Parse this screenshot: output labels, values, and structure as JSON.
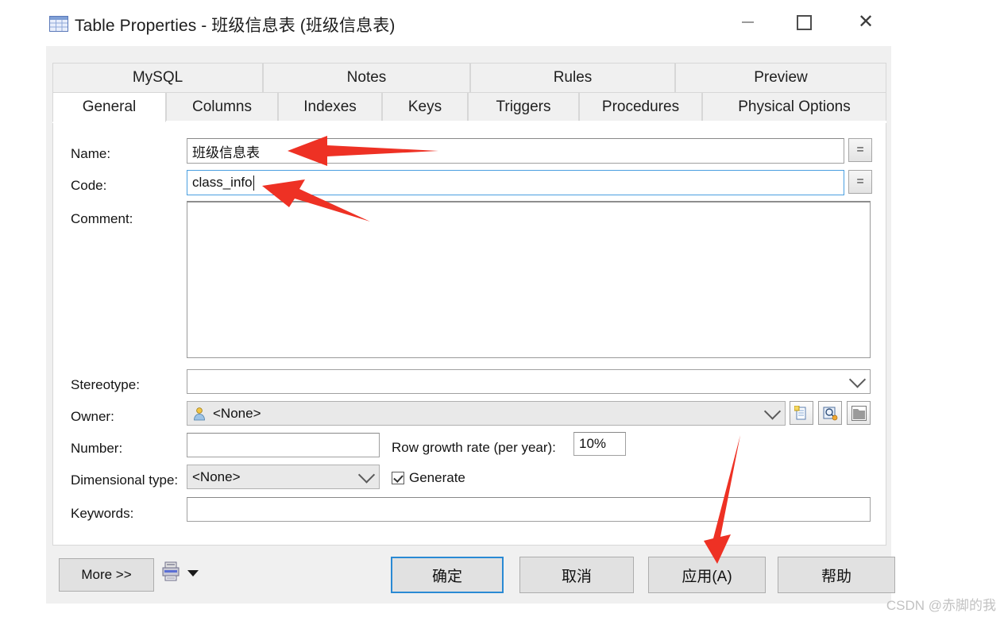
{
  "window": {
    "title": "Table Properties - 班级信息表 (班级信息表)",
    "icon": "table-icon",
    "controls": {
      "minimize": "minimize-icon",
      "maximize": "maximize-icon",
      "close": "close-icon"
    }
  },
  "tabs": {
    "top_row": [
      {
        "label": "MySQL",
        "active": false
      },
      {
        "label": "Notes",
        "active": false
      },
      {
        "label": "Rules",
        "active": false
      },
      {
        "label": "Preview",
        "active": false
      }
    ],
    "bottom_row": [
      {
        "label": "General",
        "active": true
      },
      {
        "label": "Columns",
        "active": false
      },
      {
        "label": "Indexes",
        "active": false
      },
      {
        "label": "Keys",
        "active": false
      },
      {
        "label": "Triggers",
        "active": false
      },
      {
        "label": "Procedures",
        "active": false
      },
      {
        "label": "Physical Options",
        "active": false
      }
    ]
  },
  "form": {
    "name": {
      "label": "Name:",
      "value": "班级信息表",
      "placeholder": "",
      "equals_button": "=",
      "focused": false
    },
    "code": {
      "label": "Code:",
      "value": "class_info",
      "placeholder": "",
      "equals_button": "=",
      "focused": true
    },
    "comment": {
      "label": "Comment:",
      "value": "",
      "placeholder": ""
    },
    "stereotype": {
      "label": "Stereotype:",
      "value": "",
      "placeholder": ""
    },
    "owner": {
      "label": "Owner:",
      "value": "<None>",
      "icon": "user-icon",
      "buttons": [
        "create-object-icon",
        "properties-icon",
        "select-object-icon"
      ]
    },
    "number": {
      "label": "Number:",
      "value": "",
      "placeholder": ""
    },
    "row_growth_rate": {
      "label": "Row growth rate (per year):",
      "value": "10%"
    },
    "dimensional_type": {
      "label": "Dimensional type:",
      "value": "<None>"
    },
    "generate": {
      "label": "Generate",
      "checked": true
    },
    "keywords": {
      "label": "Keywords:",
      "value": "",
      "placeholder": ""
    }
  },
  "footer": {
    "more_button": "More >>",
    "print_icon": "printer-icon",
    "print_caret": "caret-down-icon",
    "ok_button": "确定",
    "cancel_button": "取消",
    "apply_button": "应用(A)",
    "help_button": "帮助"
  },
  "annotations": {
    "arrow_color": "#ee3124",
    "arrows": [
      {
        "target": "name-input",
        "direction": "left"
      },
      {
        "target": "code-input",
        "direction": "upper-left"
      },
      {
        "target": "apply-button",
        "direction": "down"
      }
    ]
  },
  "watermark": {
    "text": "CSDN @赤脚的我"
  }
}
